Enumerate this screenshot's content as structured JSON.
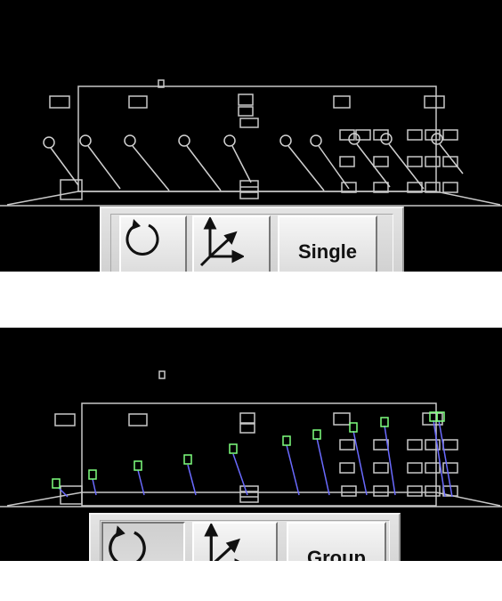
{
  "views": [
    {
      "mode_label": "Single",
      "rotate_icon": "rotate-icon",
      "axes_icon": "xyz-axes-icon",
      "rotate_pressed": false
    },
    {
      "mode_label": "Group",
      "rotate_icon": "rotate-icon",
      "axes_icon": "xyz-axes-icon",
      "rotate_pressed": true
    }
  ],
  "colors": {
    "background": "#000000",
    "wireframe": "#c8c8c8",
    "selected_label": "#7fff7f",
    "leader_line_group": "#6a6aff",
    "leader_line_single": "#d0d0d0"
  }
}
